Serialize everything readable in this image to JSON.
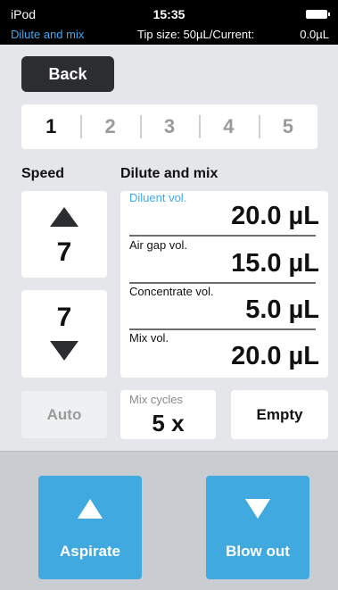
{
  "status_bar": {
    "carrier": "iPod",
    "time": "15:35",
    "mode": "Dilute and mix",
    "tip_size": "Tip size:  50µL/Current:",
    "current": "0.0µL"
  },
  "back_label": "Back",
  "steps": [
    "1",
    "2",
    "3",
    "4",
    "5"
  ],
  "active_step": "1",
  "speed": {
    "label": "Speed",
    "aspirate_value": "7",
    "dispense_value": "7"
  },
  "mode_title": "Dilute and mix",
  "volumes": [
    {
      "label": "Diluent vol.",
      "value": "20.0  µL",
      "highlighted": true
    },
    {
      "label": "Air gap vol.",
      "value": "15.0  µL",
      "highlighted": false
    },
    {
      "label": "Concentrate vol.",
      "value": "5.0  µL",
      "highlighted": false
    },
    {
      "label": "Mix vol.",
      "value": "20.0  µL",
      "highlighted": false
    }
  ],
  "auto_label": "Auto",
  "mix_cycles": {
    "label": "Mix cycles",
    "value": "5 x"
  },
  "empty_label": "Empty",
  "aspirate_label": "Aspirate",
  "blowout_label": "Blow out",
  "colors": {
    "accent": "#3fa9e0",
    "dark": "#2b2d31",
    "background": "#e4e6e9"
  },
  "icons": {
    "up": "triangle-up-icon",
    "down": "triangle-down-icon",
    "battery": "battery-icon"
  }
}
